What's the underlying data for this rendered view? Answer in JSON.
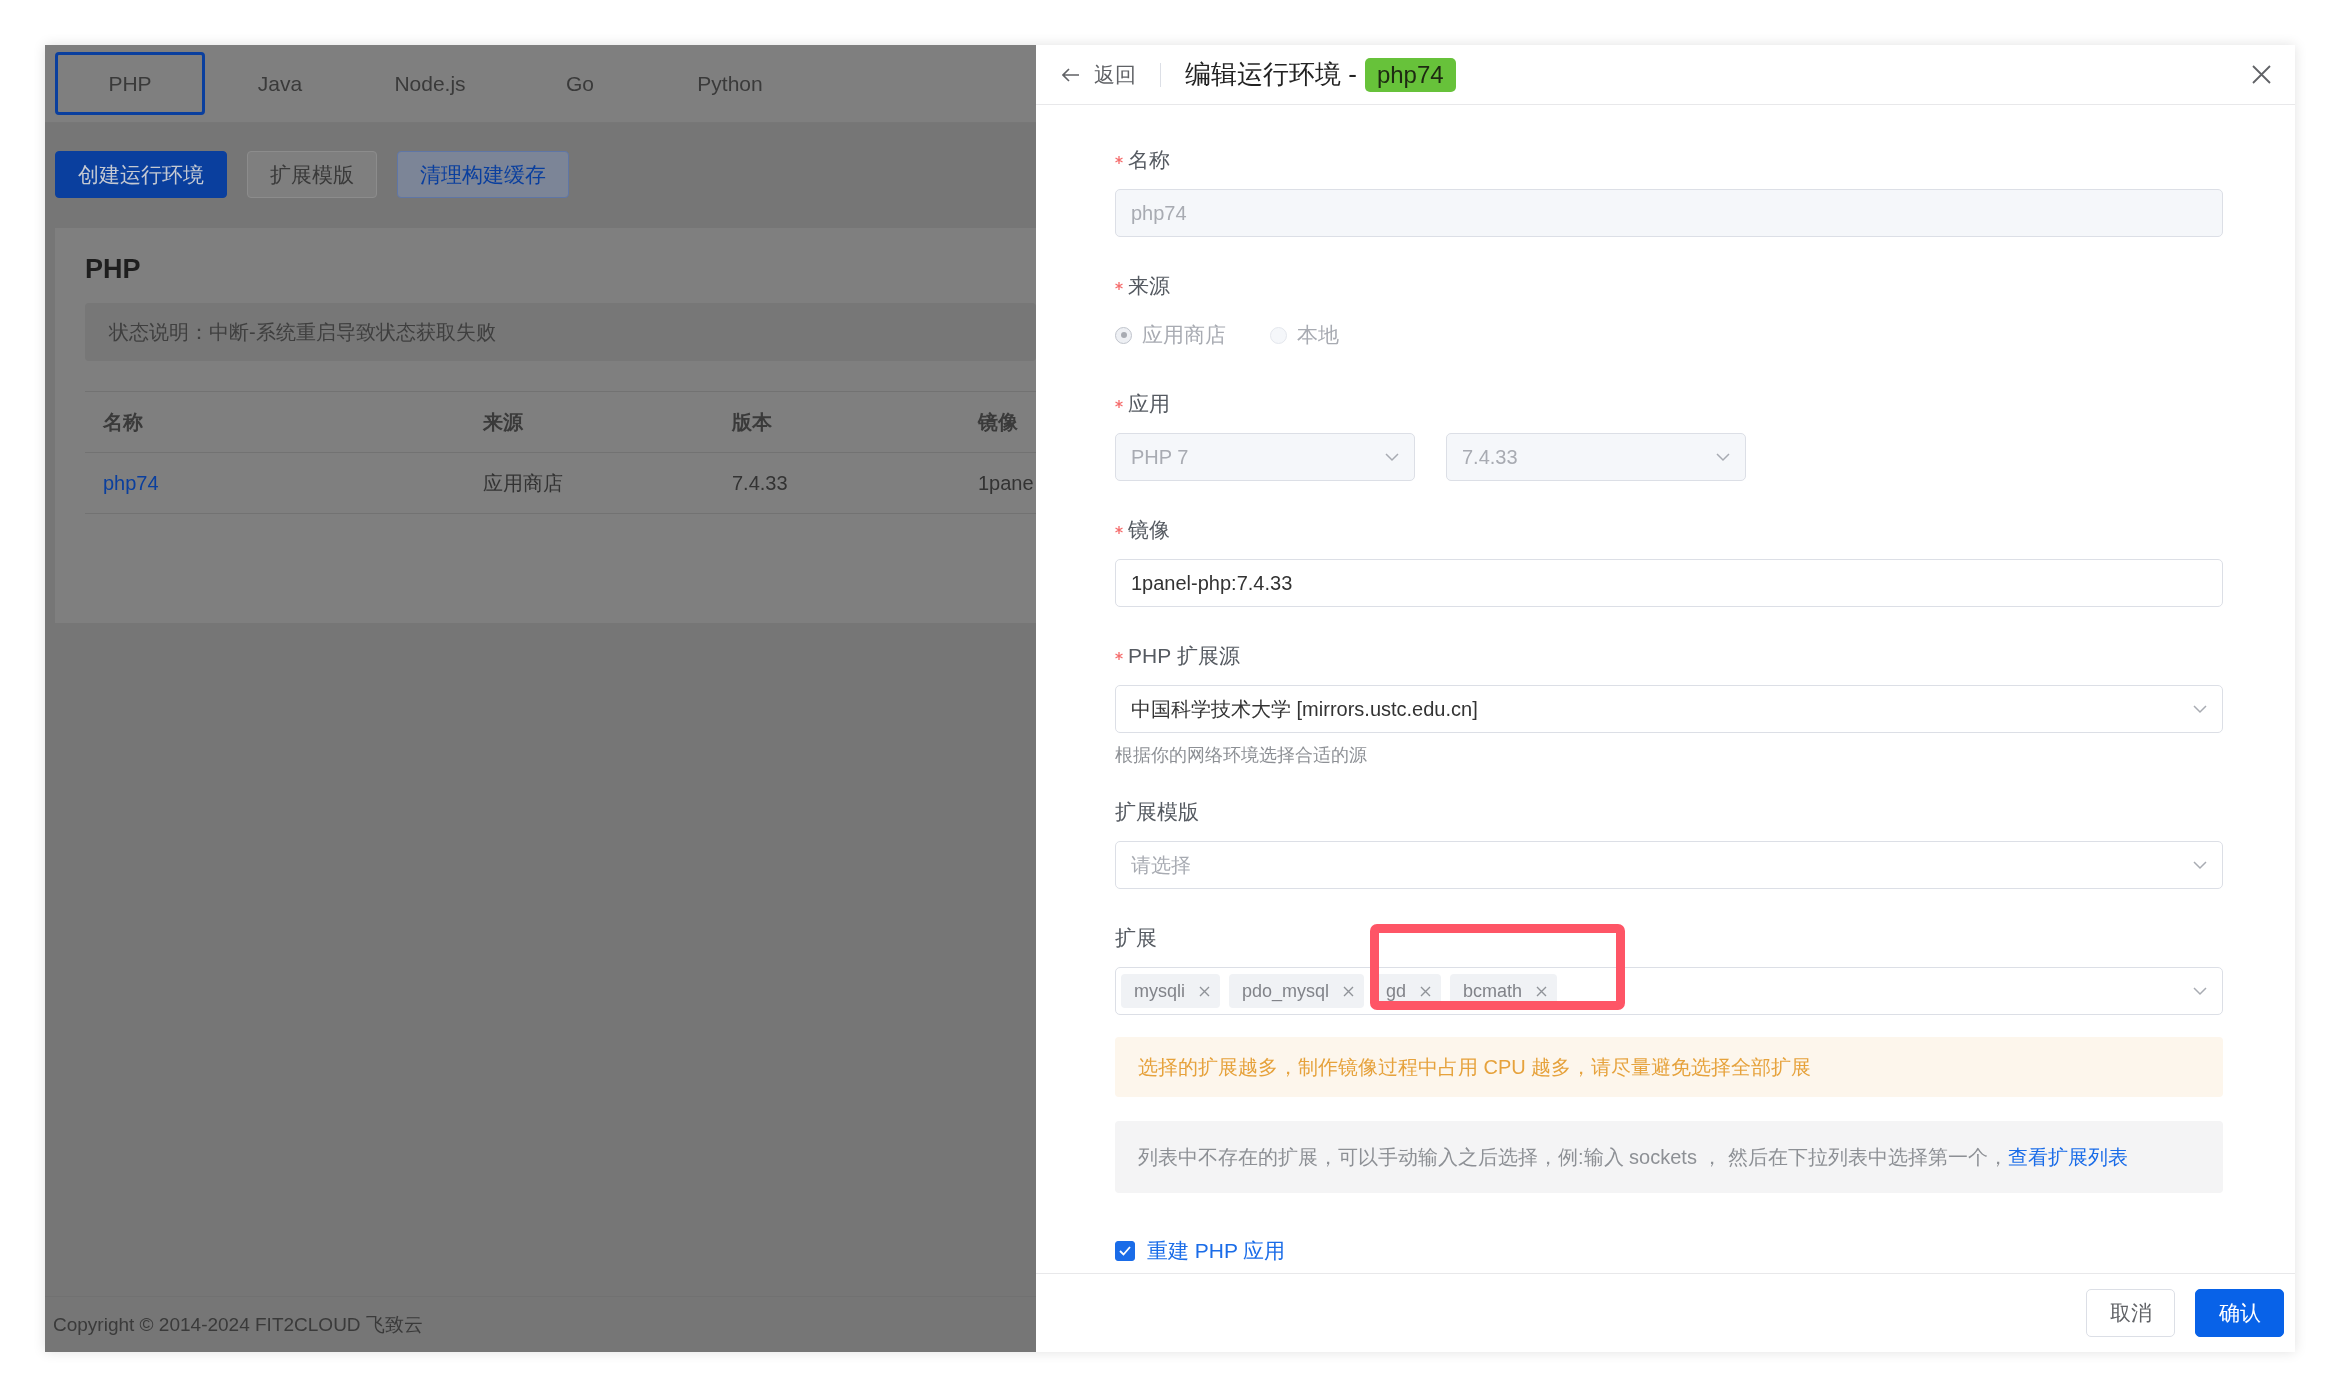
{
  "background": {
    "tabs": [
      {
        "label": "PHP",
        "selected": true
      },
      {
        "label": "Java",
        "selected": false
      },
      {
        "label": "Node.js",
        "selected": false
      },
      {
        "label": "Go",
        "selected": false
      },
      {
        "label": "Python",
        "selected": false
      }
    ],
    "actions": [
      {
        "label": "创建运行环境",
        "kind": "primary"
      },
      {
        "label": "扩展模版",
        "kind": "plain"
      },
      {
        "label": "清理构建缓存",
        "kind": "light"
      }
    ],
    "card": {
      "title": "PHP",
      "status_note": "状态说明：中断-系统重启导致状态获取失败",
      "columns": [
        "名称",
        "来源",
        "版本",
        "镜像"
      ],
      "rows": [
        [
          "php74",
          "应用商店",
          "7.4.33",
          "1pane"
        ]
      ]
    },
    "copyright": "Copyright © 2014-2024 FIT2CLOUD 飞致云"
  },
  "drawer": {
    "back": "返回",
    "title": "编辑运行环境 -",
    "title_tag": "php74",
    "fields": [
      {
        "kind": "input",
        "label": "名称",
        "required": true,
        "value": "php74",
        "disabled": true
      },
      {
        "kind": "radio",
        "label": "来源",
        "required": true,
        "disabled": true,
        "options": [
          {
            "label": "应用商店",
            "selected": true
          },
          {
            "label": "本地",
            "selected": false
          }
        ]
      },
      {
        "kind": "selects",
        "label": "应用",
        "required": true,
        "disabled": true,
        "values": [
          "PHP 7",
          "7.4.33"
        ]
      },
      {
        "kind": "input",
        "label": "镜像",
        "required": true,
        "value": "1panel-php:7.4.33",
        "disabled": false
      },
      {
        "kind": "select",
        "label": "PHP 扩展源",
        "required": true,
        "value": "中国科学技术大学 [mirrors.ustc.edu.cn]",
        "hint": "根据你的网络环境选择合适的源"
      },
      {
        "kind": "select",
        "label": "扩展模版",
        "required": false,
        "placeholder": "请选择"
      },
      {
        "kind": "tags",
        "label": "扩展",
        "required": false,
        "tags": [
          "mysqli",
          "pdo_mysql",
          "gd",
          "bcmath"
        ],
        "warning": "选择的扩展越多，制作镜像过程中占用 CPU 越多，请尽量避免选择全部扩展",
        "info": "列表中不存在的扩展，可以手动输入之后选择，例:输入 sockets ， 然后在下拉列表中选择第一个，",
        "info_link": "查看扩展列表"
      },
      {
        "kind": "checkbox",
        "label": "重建 PHP 应用",
        "checked": true
      }
    ],
    "buttons": [
      {
        "label": "取消",
        "kind": "plain"
      },
      {
        "label": "确认",
        "kind": "primary"
      }
    ]
  }
}
